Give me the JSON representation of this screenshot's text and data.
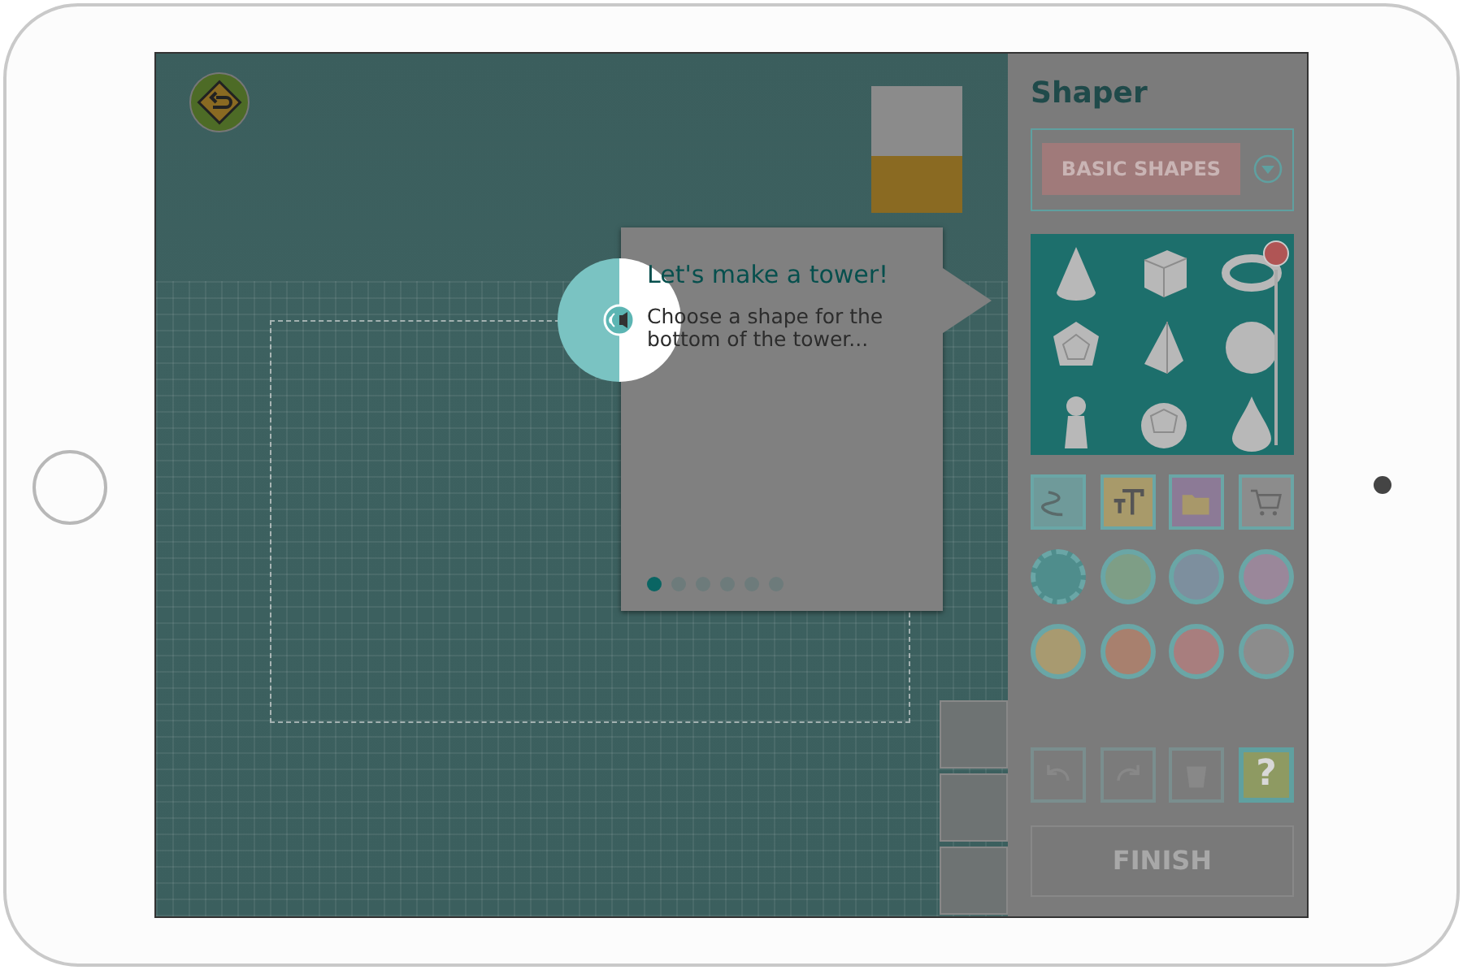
{
  "tutorial": {
    "title": "Let's make a tower!",
    "text": "Choose a shape for the bottom of the tower...",
    "steps": [
      {
        "selected": true
      },
      {
        "selected": false
      },
      {
        "selected": false
      },
      {
        "selected": false
      },
      {
        "selected": false
      },
      {
        "selected": false
      }
    ]
  },
  "panel": {
    "title": "Shaper",
    "library": "BASIC SHAPES",
    "shapes": [
      {
        "kind": "cone"
      },
      {
        "kind": "cube"
      },
      {
        "kind": "torus"
      },
      {
        "kind": "dodecahedron"
      },
      {
        "kind": "pyramid"
      },
      {
        "kind": "sphere"
      },
      {
        "kind": "pawn"
      },
      {
        "kind": "polyhedron"
      },
      {
        "kind": "drop"
      }
    ],
    "tools": [
      {
        "kind": "pattern"
      },
      {
        "kind": "text"
      },
      {
        "kind": "folder"
      },
      {
        "kind": "cart"
      }
    ],
    "swatches": [
      {
        "color": "#4f8d8c",
        "kind": "add"
      },
      {
        "color": "#7e9e86",
        "kind": "plain"
      },
      {
        "color": "#7d8f9e",
        "kind": "plain"
      },
      {
        "color": "#9a879a",
        "kind": "plain"
      },
      {
        "color": "#a89a70",
        "kind": "plain"
      },
      {
        "color": "#a8806e",
        "kind": "plain"
      },
      {
        "color": "#a87e7e",
        "kind": "plain"
      },
      {
        "color": "#8c8c8c",
        "kind": "plain"
      }
    ],
    "actions": [
      {
        "kind": "undo"
      },
      {
        "kind": "redo"
      },
      {
        "kind": "trash"
      },
      {
        "kind": "help",
        "label": "?"
      }
    ],
    "finish": "FINISH"
  }
}
